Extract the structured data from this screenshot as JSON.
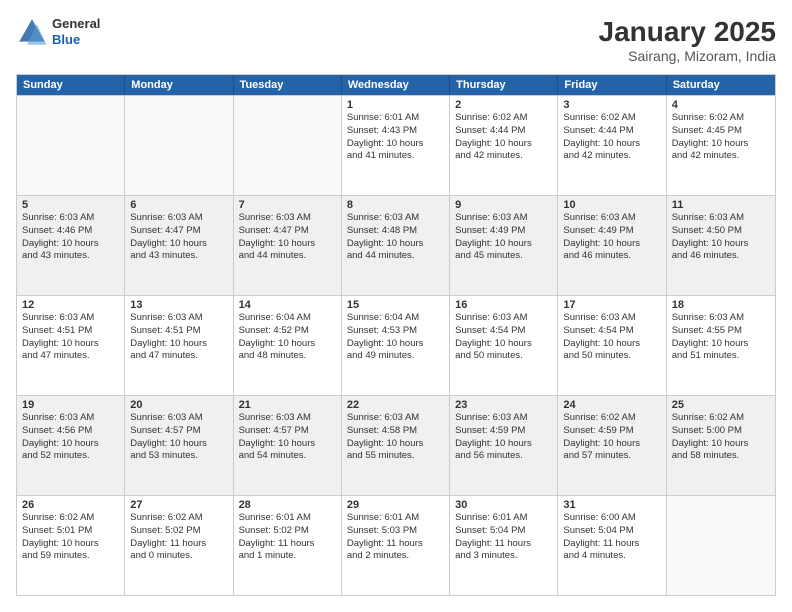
{
  "header": {
    "logo": {
      "general": "General",
      "blue": "Blue"
    },
    "title": "January 2025",
    "location": "Sairang, Mizoram, India"
  },
  "days_of_week": [
    "Sunday",
    "Monday",
    "Tuesday",
    "Wednesday",
    "Thursday",
    "Friday",
    "Saturday"
  ],
  "weeks": [
    [
      {
        "day": "",
        "info": "",
        "empty": true
      },
      {
        "day": "",
        "info": "",
        "empty": true
      },
      {
        "day": "",
        "info": "",
        "empty": true
      },
      {
        "day": "1",
        "info": "Sunrise: 6:01 AM\nSunset: 4:43 PM\nDaylight: 10 hours\nand 41 minutes."
      },
      {
        "day": "2",
        "info": "Sunrise: 6:02 AM\nSunset: 4:44 PM\nDaylight: 10 hours\nand 42 minutes."
      },
      {
        "day": "3",
        "info": "Sunrise: 6:02 AM\nSunset: 4:44 PM\nDaylight: 10 hours\nand 42 minutes."
      },
      {
        "day": "4",
        "info": "Sunrise: 6:02 AM\nSunset: 4:45 PM\nDaylight: 10 hours\nand 42 minutes."
      }
    ],
    [
      {
        "day": "5",
        "info": "Sunrise: 6:03 AM\nSunset: 4:46 PM\nDaylight: 10 hours\nand 43 minutes.",
        "shaded": true
      },
      {
        "day": "6",
        "info": "Sunrise: 6:03 AM\nSunset: 4:47 PM\nDaylight: 10 hours\nand 43 minutes.",
        "shaded": true
      },
      {
        "day": "7",
        "info": "Sunrise: 6:03 AM\nSunset: 4:47 PM\nDaylight: 10 hours\nand 44 minutes.",
        "shaded": true
      },
      {
        "day": "8",
        "info": "Sunrise: 6:03 AM\nSunset: 4:48 PM\nDaylight: 10 hours\nand 44 minutes.",
        "shaded": true
      },
      {
        "day": "9",
        "info": "Sunrise: 6:03 AM\nSunset: 4:49 PM\nDaylight: 10 hours\nand 45 minutes.",
        "shaded": true
      },
      {
        "day": "10",
        "info": "Sunrise: 6:03 AM\nSunset: 4:49 PM\nDaylight: 10 hours\nand 46 minutes.",
        "shaded": true
      },
      {
        "day": "11",
        "info": "Sunrise: 6:03 AM\nSunset: 4:50 PM\nDaylight: 10 hours\nand 46 minutes.",
        "shaded": true
      }
    ],
    [
      {
        "day": "12",
        "info": "Sunrise: 6:03 AM\nSunset: 4:51 PM\nDaylight: 10 hours\nand 47 minutes."
      },
      {
        "day": "13",
        "info": "Sunrise: 6:03 AM\nSunset: 4:51 PM\nDaylight: 10 hours\nand 47 minutes."
      },
      {
        "day": "14",
        "info": "Sunrise: 6:04 AM\nSunset: 4:52 PM\nDaylight: 10 hours\nand 48 minutes."
      },
      {
        "day": "15",
        "info": "Sunrise: 6:04 AM\nSunset: 4:53 PM\nDaylight: 10 hours\nand 49 minutes."
      },
      {
        "day": "16",
        "info": "Sunrise: 6:03 AM\nSunset: 4:54 PM\nDaylight: 10 hours\nand 50 minutes."
      },
      {
        "day": "17",
        "info": "Sunrise: 6:03 AM\nSunset: 4:54 PM\nDaylight: 10 hours\nand 50 minutes."
      },
      {
        "day": "18",
        "info": "Sunrise: 6:03 AM\nSunset: 4:55 PM\nDaylight: 10 hours\nand 51 minutes."
      }
    ],
    [
      {
        "day": "19",
        "info": "Sunrise: 6:03 AM\nSunset: 4:56 PM\nDaylight: 10 hours\nand 52 minutes.",
        "shaded": true
      },
      {
        "day": "20",
        "info": "Sunrise: 6:03 AM\nSunset: 4:57 PM\nDaylight: 10 hours\nand 53 minutes.",
        "shaded": true
      },
      {
        "day": "21",
        "info": "Sunrise: 6:03 AM\nSunset: 4:57 PM\nDaylight: 10 hours\nand 54 minutes.",
        "shaded": true
      },
      {
        "day": "22",
        "info": "Sunrise: 6:03 AM\nSunset: 4:58 PM\nDaylight: 10 hours\nand 55 minutes.",
        "shaded": true
      },
      {
        "day": "23",
        "info": "Sunrise: 6:03 AM\nSunset: 4:59 PM\nDaylight: 10 hours\nand 56 minutes.",
        "shaded": true
      },
      {
        "day": "24",
        "info": "Sunrise: 6:02 AM\nSunset: 4:59 PM\nDaylight: 10 hours\nand 57 minutes.",
        "shaded": true
      },
      {
        "day": "25",
        "info": "Sunrise: 6:02 AM\nSunset: 5:00 PM\nDaylight: 10 hours\nand 58 minutes.",
        "shaded": true
      }
    ],
    [
      {
        "day": "26",
        "info": "Sunrise: 6:02 AM\nSunset: 5:01 PM\nDaylight: 10 hours\nand 59 minutes."
      },
      {
        "day": "27",
        "info": "Sunrise: 6:02 AM\nSunset: 5:02 PM\nDaylight: 11 hours\nand 0 minutes."
      },
      {
        "day": "28",
        "info": "Sunrise: 6:01 AM\nSunset: 5:02 PM\nDaylight: 11 hours\nand 1 minute."
      },
      {
        "day": "29",
        "info": "Sunrise: 6:01 AM\nSunset: 5:03 PM\nDaylight: 11 hours\nand 2 minutes."
      },
      {
        "day": "30",
        "info": "Sunrise: 6:01 AM\nSunset: 5:04 PM\nDaylight: 11 hours\nand 3 minutes."
      },
      {
        "day": "31",
        "info": "Sunrise: 6:00 AM\nSunset: 5:04 PM\nDaylight: 11 hours\nand 4 minutes."
      },
      {
        "day": "",
        "info": "",
        "empty": true
      }
    ]
  ]
}
